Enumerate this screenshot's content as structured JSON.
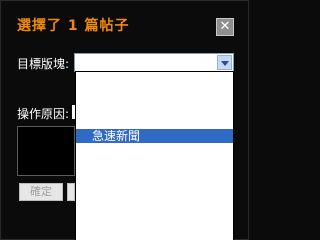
{
  "dialog": {
    "title": "選擇了 1 篇帖子",
    "close_glyph": "✕"
  },
  "form": {
    "target_label": "目標版塊:",
    "reason_label": "操作原因:",
    "select_value": ""
  },
  "buttons": {
    "confirm_label": "確定",
    "cancel_label": ""
  },
  "dropdown": {
    "items": [
      {
        "label": "急速新聞",
        "selected": true
      }
    ]
  },
  "colors": {
    "title": "#f08a0c",
    "background": "#0b0b0b",
    "selection": "#316ac5"
  }
}
